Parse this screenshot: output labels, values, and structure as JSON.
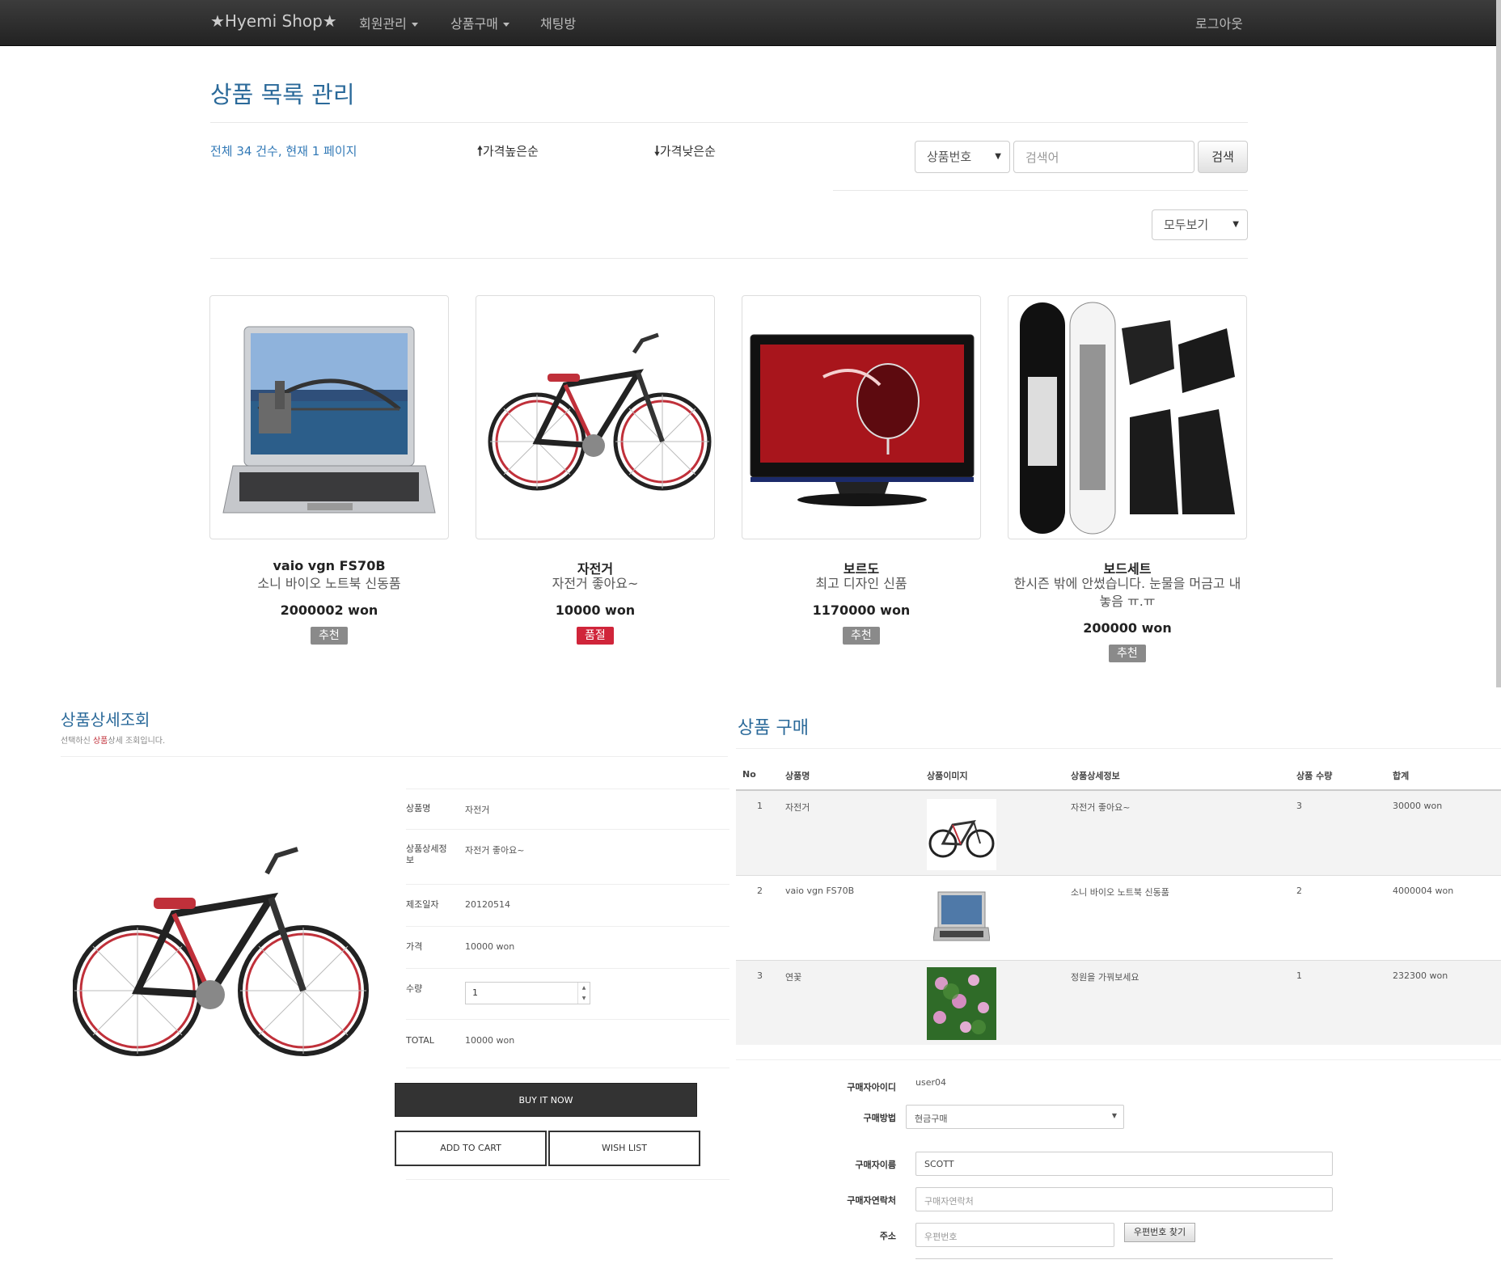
{
  "navbar": {
    "brand": "★Hyemi Shop★",
    "menu_member": "회원관리",
    "menu_purchase": "상품구매",
    "menu_chat": "채팅방",
    "logout": "로그아웃"
  },
  "listing": {
    "title": "상품 목록 관리",
    "count_text": "전체 34 건수, 현재 1 페이지",
    "sort_high": "가격높은순",
    "sort_low": "가격낮은순",
    "search_field": "상품번호",
    "search_placeholder": "검색어",
    "search_button": "검색",
    "view_filter": "모두보기",
    "products": [
      {
        "name": "vaio vgn FS70B",
        "desc": "소니 바이오 노트북 신동품",
        "desc2": "",
        "price": "2000002 won",
        "badge": "추천",
        "image": "laptop-image"
      },
      {
        "name": "자전거",
        "desc": "자전거 좋아요~",
        "desc2": "",
        "price": "10000 won",
        "badge": "품절",
        "image": "bicycle-image"
      },
      {
        "name": "보르도",
        "desc": "최고 디자인 신품",
        "desc2": "",
        "price": "1170000 won",
        "badge": "추천",
        "image": "tv-image"
      },
      {
        "name": "보드세트",
        "desc": "한시즌 밖에 안썼습니다. 눈물을 머금고 내",
        "desc2": "놓음 ㅠ.ㅠ",
        "price": "200000 won",
        "badge": "추천",
        "image": "snowboard-image"
      }
    ]
  },
  "detail": {
    "title": "상품상세조회",
    "subtitle_pre": "선택하신 ",
    "subtitle_hl": "상품",
    "subtitle_post": "상세 조회입니다.",
    "label_name": "상품명",
    "value_name": "자전거",
    "label_desc1": "상품상세정",
    "label_desc2": "보",
    "value_desc": "자전거 좋아요~",
    "label_date": "제조일자",
    "value_date": "20120514",
    "label_price": "가격",
    "value_price": "10000 won",
    "label_qty": "수량",
    "value_qty": "1",
    "label_total": "TOTAL",
    "value_total": "10000 won",
    "btn_buy": "BUY IT NOW",
    "btn_cart": "ADD TO CART",
    "btn_wish": "WISH LIST"
  },
  "purchase": {
    "title": "상품 구매",
    "headers": [
      "No",
      "상품명",
      "상품이미지",
      "상품상세정보",
      "상품 수량",
      "합계"
    ],
    "rows": [
      {
        "no": "1",
        "name": "자전거",
        "image": "bicycle-thumb",
        "info": "자전거 좋아요~",
        "qty": "3",
        "total": "30000 won"
      },
      {
        "no": "2",
        "name": "vaio vgn FS70B",
        "image": "laptop-thumb",
        "info": "소니 바이오 노트북 신동품",
        "qty": "2",
        "total": "4000004 won"
      },
      {
        "no": "3",
        "name": "연꽃",
        "image": "lotus-thumb",
        "info": "정원을 가꿔보세요",
        "qty": "1",
        "total": "232300 won"
      }
    ],
    "buyer_id_label": "구매자아이디",
    "buyer_id": "user04",
    "method_label": "구매방법",
    "method_value": "현금구매",
    "buyer_name_label": "구매자이름",
    "buyer_name": "SCOTT",
    "contact_label": "구매자연락처",
    "contact_placeholder": "구매자연락처",
    "address_label": "주소",
    "zipcode_placeholder": "우편번호",
    "zipcode_button": "우편번호 찾기"
  },
  "colors": {
    "navbar": "#2a2a2a",
    "link": "#337ab7",
    "title": "#2b6a9a",
    "badge_recommend": "#8a8a8a",
    "badge_soldout": "#d0253a"
  }
}
